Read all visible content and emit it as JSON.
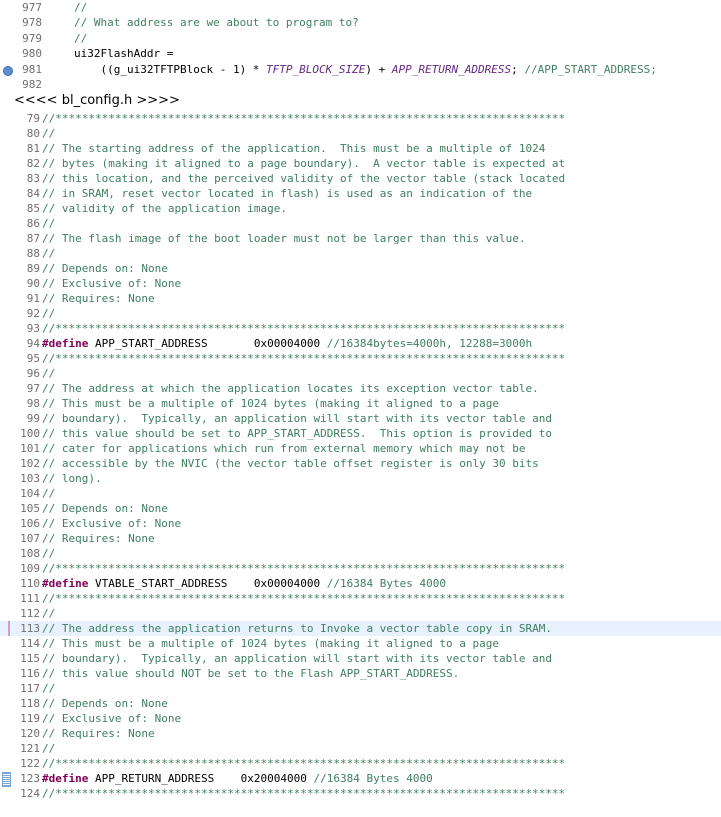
{
  "top_editor": {
    "lines": [
      {
        "n": "977",
        "code": "//"
      },
      {
        "n": "978",
        "code": "// What address are we about to program to?"
      },
      {
        "n": "979",
        "code": "//"
      },
      {
        "n": "980",
        "code": "ui32FlashAddr ="
      },
      {
        "n": "981",
        "code_a": "    ((g_ui32TFTPBlock - 1) * ",
        "code_macro1": "TFTP_BLOCK_SIZE",
        "code_b": ") + ",
        "code_macro2": "APP_RETURN_ADDRESS",
        "code_c": "; ",
        "code_comment": "//APP_START_ADDRESS;"
      },
      {
        "n": "982",
        "code": ""
      }
    ]
  },
  "file_header": "<<<< bl_config.h >>>>",
  "bottom_editor": {
    "lines": [
      {
        "n": "79",
        "code": "//*****************************************************************************"
      },
      {
        "n": "80",
        "code": "//"
      },
      {
        "n": "81",
        "code": "// The starting address of the application.  This must be a multiple of 1024"
      },
      {
        "n": "82",
        "code": "// bytes (making it aligned to a page boundary).  A vector table is expected at"
      },
      {
        "n": "83",
        "code": "// this location, and the perceived validity of the vector table (stack located"
      },
      {
        "n": "84",
        "code": "// in SRAM, reset vector located in flash) is used as an indication of the"
      },
      {
        "n": "85",
        "code": "// validity of the application image."
      },
      {
        "n": "86",
        "code": "//"
      },
      {
        "n": "87",
        "code": "// The flash image of the boot loader must not be larger than this value."
      },
      {
        "n": "88",
        "code": "//"
      },
      {
        "n": "89",
        "code": "// Depends on: None"
      },
      {
        "n": "90",
        "code": "// Exclusive of: None"
      },
      {
        "n": "91",
        "code": "// Requires: None"
      },
      {
        "n": "92",
        "code": "//"
      },
      {
        "n": "93",
        "code": "//*****************************************************************************"
      },
      {
        "n": "94",
        "define": "#define",
        "rest": " APP_START_ADDRESS       0x00004000 ",
        "comment": "//16384bytes=4000h, 12288=3000h"
      },
      {
        "n": "95",
        "code": "//*****************************************************************************"
      },
      {
        "n": "96",
        "code": "//"
      },
      {
        "n": "97",
        "code": "// The address at which the application locates its exception vector table."
      },
      {
        "n": "98",
        "code": "// This must be a multiple of 1024 bytes (making it aligned to a page"
      },
      {
        "n": "99",
        "code": "// boundary).  Typically, an application will start with its vector table and"
      },
      {
        "n": "100",
        "code": "// this value should be set to APP_START_ADDRESS.  This option is provided to"
      },
      {
        "n": "101",
        "code": "// cater for applications which run from external memory which may not be"
      },
      {
        "n": "102",
        "code": "// accessible by the NVIC (the vector table offset register is only 30 bits"
      },
      {
        "n": "103",
        "code": "// long)."
      },
      {
        "n": "104",
        "code": "//"
      },
      {
        "n": "105",
        "code": "// Depends on: None"
      },
      {
        "n": "106",
        "code": "// Exclusive of: None"
      },
      {
        "n": "107",
        "code": "// Requires: None"
      },
      {
        "n": "108",
        "code": "//"
      },
      {
        "n": "109",
        "code": "//*****************************************************************************"
      },
      {
        "n": "110",
        "define": "#define",
        "rest": " VTABLE_START_ADDRESS    0x00004000 ",
        "comment": "//16384 Bytes 4000"
      },
      {
        "n": "111",
        "code": "//*****************************************************************************"
      },
      {
        "n": "112",
        "code": "//"
      },
      {
        "n": "113",
        "code": "// The address the application returns to Invoke a vector table copy in SRAM."
      },
      {
        "n": "114",
        "code": "// This must be a multiple of 1024 bytes (making it aligned to a page"
      },
      {
        "n": "115",
        "code": "// boundary).  Typically, an application will start with its vector table and"
      },
      {
        "n": "116",
        "code": "// this value should NOT be set to the Flash APP_START_ADDRESS."
      },
      {
        "n": "117",
        "code": "//"
      },
      {
        "n": "118",
        "code": "// Depends on: None"
      },
      {
        "n": "119",
        "code": "// Exclusive of: None"
      },
      {
        "n": "120",
        "code": "// Requires: None"
      },
      {
        "n": "121",
        "code": "//"
      },
      {
        "n": "122",
        "code": "//*****************************************************************************"
      },
      {
        "n": "123",
        "define": "#define",
        "rest": " APP_RETURN_ADDRESS    0x20004000 ",
        "comment": "//16384 Bytes 4000"
      },
      {
        "n": "124",
        "code": "//*****************************************************************************"
      }
    ]
  },
  "colors": {
    "comment": "#3f7f5f",
    "keyword": "#7f0055",
    "macro": "#642880",
    "line_number": "#6f6f6f",
    "current_line_bg": "#e8f2fe",
    "breakpoint": "#5b8fcf"
  }
}
